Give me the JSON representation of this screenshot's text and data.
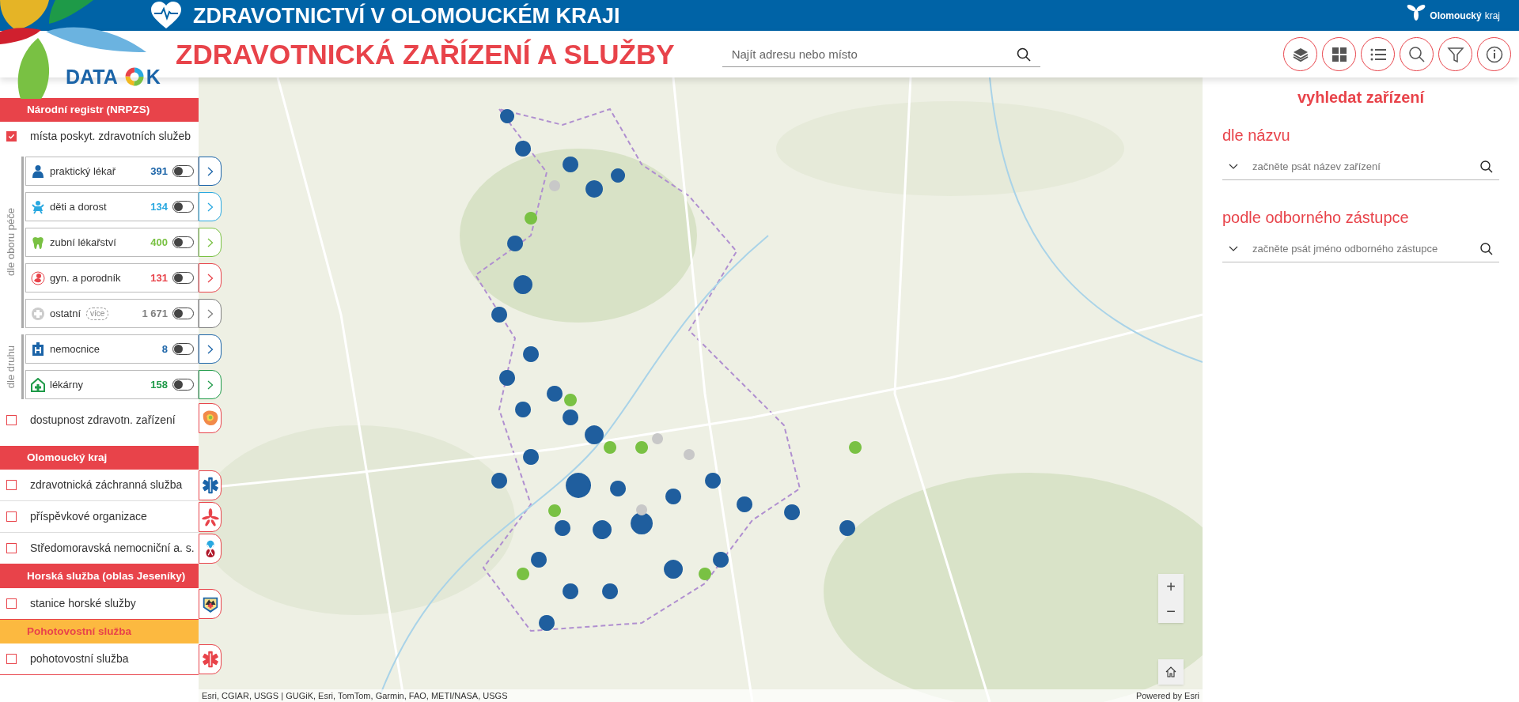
{
  "header": {
    "title": "ZDRAVOTNICTVÍ V OLOMOUCKÉM KRAJI",
    "brand": "Olomoucký",
    "brand_suffix": "kraj"
  },
  "logo": {
    "word": "DATA",
    "letter": "K"
  },
  "page_title": "ZDRAVOTNICKÁ ZAŘÍZENÍ A SLUŽBY",
  "search": {
    "placeholder": "Najít adresu nebo místo"
  },
  "sidebar": [
    {
      "title": "Národní registr (NRPZS)",
      "kind": "red",
      "items": [
        {
          "kind": "checkbox",
          "label": "místa poskyt. zdravotních služeb",
          "checked": true
        },
        {
          "kind": "group",
          "label": "dle oboru péče",
          "layers": [
            {
              "name": "praktický lékař",
              "count": "391",
              "color": "#1b64a8",
              "on": false
            },
            {
              "name": "děti a dorost",
              "count": "134",
              "color": "#29a8e0",
              "on": false
            },
            {
              "name": "zubní lékařství",
              "count": "400",
              "color": "#79c143",
              "on": false
            },
            {
              "name": "gyn. a porodník",
              "count": "131",
              "color": "#e8434a",
              "on": false
            },
            {
              "name": "ostatní",
              "badge": "více",
              "count": "1 671",
              "color": "#808080",
              "on": false
            }
          ]
        },
        {
          "kind": "group",
          "label": "dle druhu",
          "layers": [
            {
              "name": "nemocnice",
              "count": "8",
              "color": "#1b64a8",
              "on": false
            },
            {
              "name": "lékárny",
              "count": "158",
              "color": "#1e9a48",
              "on": false
            }
          ]
        },
        {
          "kind": "checkbox",
          "label": "dostupnost zdravotn. zařízení",
          "checked": false
        }
      ]
    },
    {
      "title": "Olomoucký kraj",
      "kind": "red",
      "items": [
        {
          "kind": "checkbox",
          "label": "zdravotnická záchranná služba",
          "checked": false
        },
        {
          "kind": "checkbox",
          "label": "příspěvkové organizace",
          "checked": false
        },
        {
          "kind": "checkbox",
          "label": "Středomoravská nemocniční a. s.",
          "checked": false
        }
      ]
    },
    {
      "title": "Horská služba (oblas Jeseníky)",
      "kind": "red",
      "items": [
        {
          "kind": "checkbox",
          "label": "stanice horské služby",
          "checked": false
        }
      ]
    },
    {
      "title": "Pohotovostní služba",
      "kind": "orange",
      "items": [
        {
          "kind": "checkbox",
          "label": "pohotovostní služba",
          "checked": false
        }
      ]
    }
  ],
  "map": {
    "zoom": [
      "+",
      "−"
    ],
    "attribution": "Esri, CGIAR, USGS | GUGiK, Esri, TomTom, Garmin, FAO, METI/NASA, USGS",
    "powered": "Powered by Esri"
  },
  "finder": {
    "title": "vyhledat zařízení",
    "searches": [
      {
        "label": "dle názvu",
        "placeholder": "začněte psát název zařízení"
      },
      {
        "label": "podle odborného zástupce",
        "placeholder": "začněte psát jméno odborného zástupce"
      }
    ]
  }
}
